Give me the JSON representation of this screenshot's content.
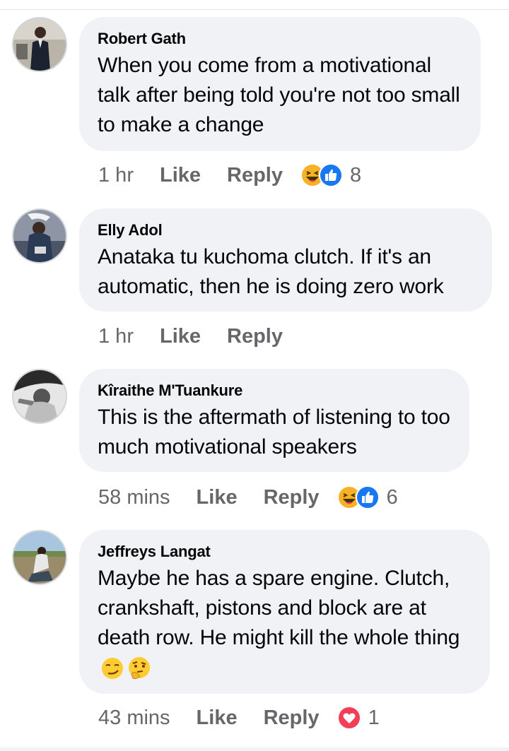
{
  "comments": [
    {
      "author": "Robert Gath",
      "text": "When you come from a motivational talk after being told you're not too small to make a change",
      "time": "1 hr",
      "like_label": "Like",
      "reply_label": "Reply",
      "reactions": [
        "haha-icon",
        "like-icon"
      ],
      "reaction_count": "8"
    },
    {
      "author": "Elly Adol",
      "text": "Anataka tu kuchoma clutch. If it's an automatic, then he is doing zero work",
      "time": "1 hr",
      "like_label": "Like",
      "reply_label": "Reply",
      "reactions": [],
      "reaction_count": ""
    },
    {
      "author": "Kîraithe M'Tuankure",
      "text": "This is the aftermath of listening to too much motivational speakers",
      "time": "58 mins",
      "like_label": "Like",
      "reply_label": "Reply",
      "reactions": [
        "haha-icon",
        "like-icon"
      ],
      "reaction_count": "6"
    },
    {
      "author": "Jeffreys Langat",
      "text": "Maybe he has a spare engine. Clutch, crankshaft, pistons and block are at death row. He might kill the whole thing",
      "trailing_emojis": [
        "smirk-emoji-icon",
        "thinking-emoji-icon"
      ],
      "time": "43 mins",
      "like_label": "Like",
      "reply_label": "Reply",
      "reactions": [
        "love-icon"
      ],
      "reaction_count": "1"
    }
  ],
  "colors": {
    "bubble": "#f0f2f5",
    "text": "#050505",
    "meta": "#65676b",
    "like_blue": "#1877f2",
    "love_red": "#f33e58",
    "haha_yellow": "#f7b125"
  }
}
